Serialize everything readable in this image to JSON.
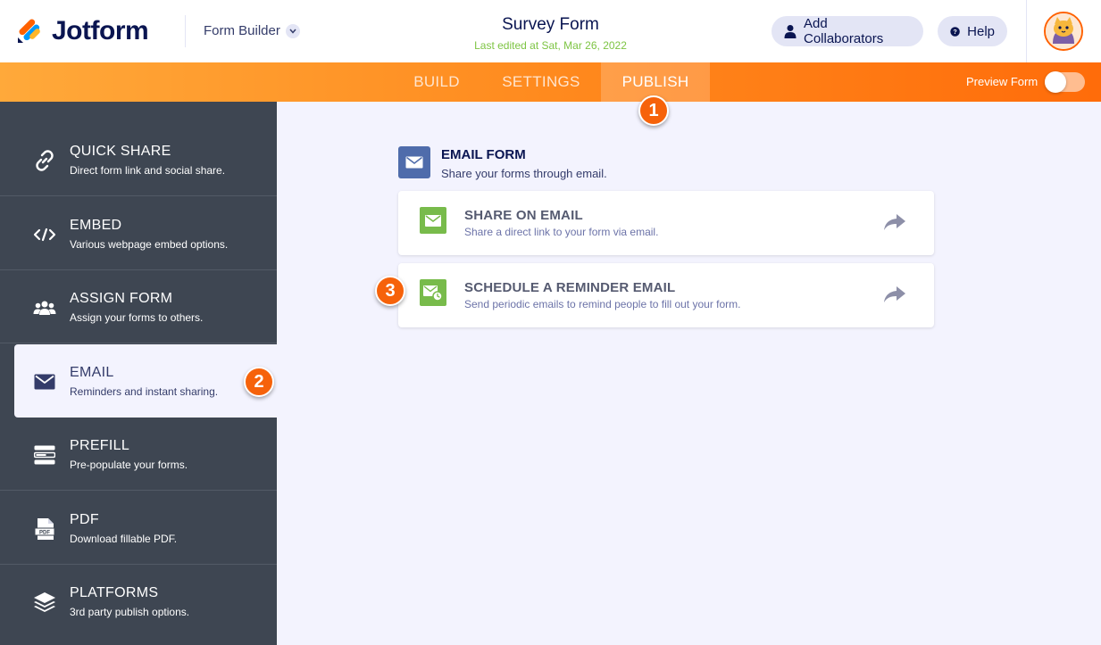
{
  "header": {
    "logo_text": "Jotform",
    "builder_label": "Form Builder",
    "form_title": "Survey Form",
    "last_edited": "Last edited at Sat, Mar 26, 2022",
    "add_collaborators": "Add Collaborators",
    "help": "Help"
  },
  "nav": {
    "tabs": [
      {
        "label": "BUILD",
        "active": false
      },
      {
        "label": "SETTINGS",
        "active": false
      },
      {
        "label": "PUBLISH",
        "active": true
      }
    ],
    "preview_label": "Preview Form",
    "preview_on": false
  },
  "sidebar": {
    "items": [
      {
        "title": "QUICK SHARE",
        "desc": "Direct form link and social share.",
        "icon": "link-icon",
        "active": false
      },
      {
        "title": "EMBED",
        "desc": "Various webpage embed options.",
        "icon": "code-icon",
        "active": false
      },
      {
        "title": "ASSIGN FORM",
        "desc": "Assign your forms to others.",
        "icon": "users-icon",
        "active": false
      },
      {
        "title": "EMAIL",
        "desc": "Reminders and instant sharing.",
        "icon": "envelope-icon",
        "active": true
      },
      {
        "title": "PREFILL",
        "desc": "Pre-populate your forms.",
        "icon": "prefill-icon",
        "active": false
      },
      {
        "title": "PDF",
        "desc": "Download fillable PDF.",
        "icon": "pdf-icon",
        "active": false
      },
      {
        "title": "PLATFORMS",
        "desc": "3rd party publish options.",
        "icon": "layers-icon",
        "active": false
      }
    ]
  },
  "main": {
    "section_title": "EMAIL FORM",
    "section_desc": "Share your forms through email.",
    "cards": [
      {
        "title": "SHARE ON EMAIL",
        "desc": "Share a direct link to your form via email.",
        "icon": "envelope-icon"
      },
      {
        "title": "SCHEDULE A REMINDER EMAIL",
        "desc": "Send periodic emails to remind people to fill out your form.",
        "icon": "envelope-clock-icon"
      }
    ]
  },
  "badges": {
    "one": "1",
    "two": "2",
    "three": "3"
  },
  "colors": {
    "accent": "#ff6100",
    "sidebar": "#3e4652",
    "card_icon": "#78bb4b",
    "badge": "#f6620a"
  }
}
